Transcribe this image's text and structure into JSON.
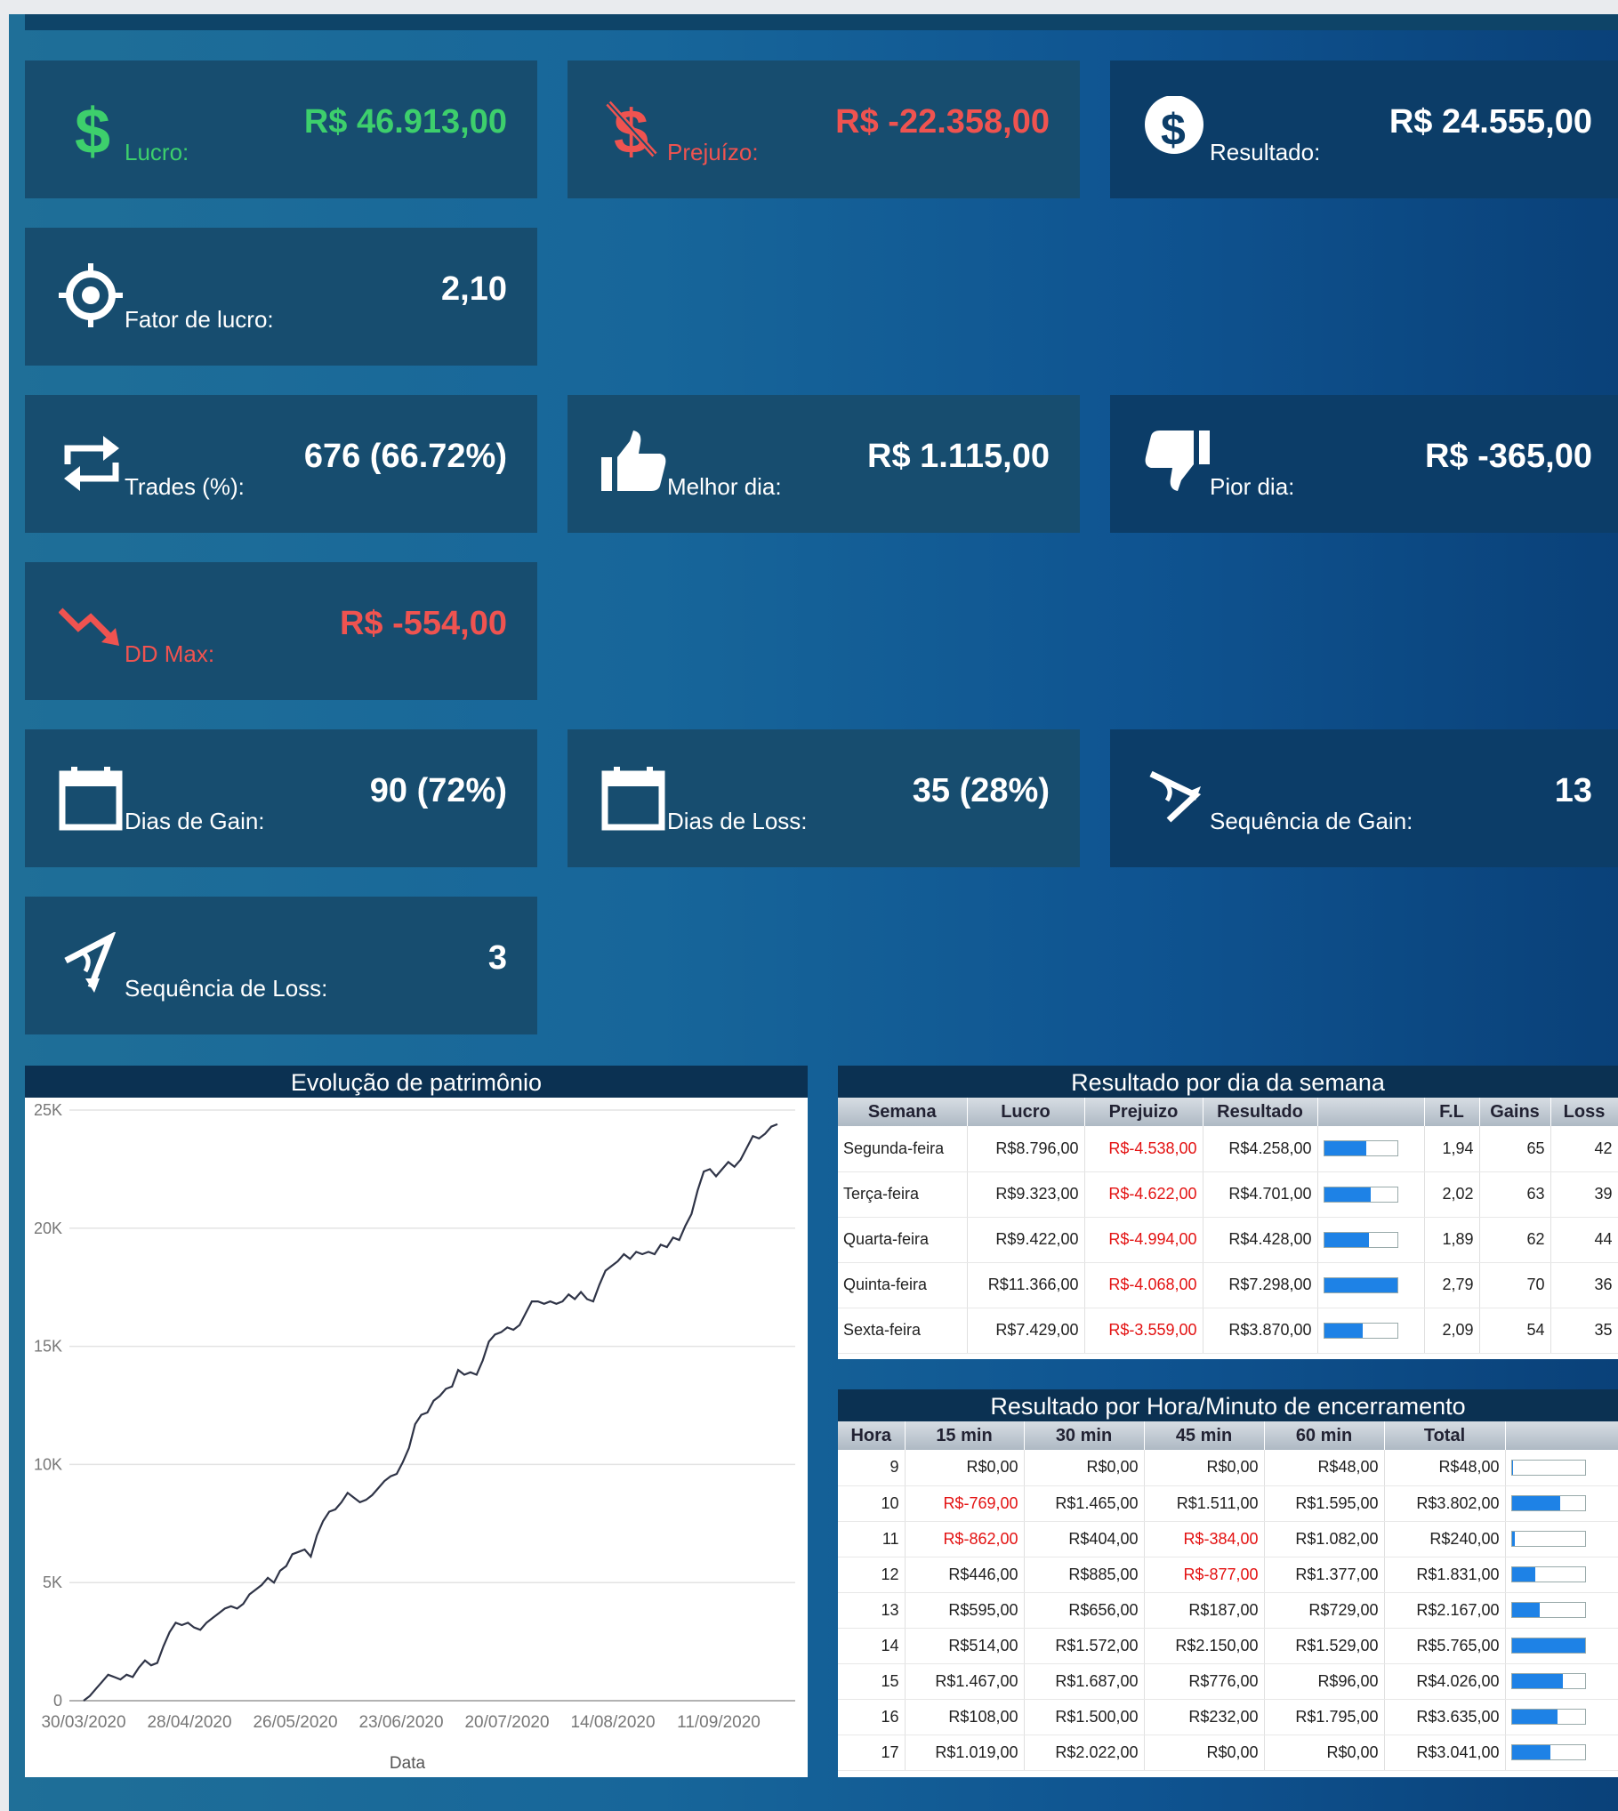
{
  "colors": {
    "positive": "#3dcf6c",
    "negative": "#ef5350",
    "card_bg": "#174d6f",
    "bar_fill": "#1e82e6"
  },
  "cards": {
    "lucro": {
      "icon": "dollar-icon",
      "label": "Lucro:",
      "value": "R$ 46.913,00"
    },
    "prejuizo": {
      "icon": "dollar-off-icon",
      "label": "Prejuízo:",
      "value": "R$ -22.358,00"
    },
    "resultado": {
      "icon": "dollar-circle-icon",
      "label": "Resultado:",
      "value": "R$ 24.555,00"
    },
    "fator": {
      "icon": "target-icon",
      "label": "Fator de lucro:",
      "value": "2,10"
    },
    "trades": {
      "icon": "repeat-icon",
      "label": "Trades (%):",
      "value": "676 (66.72%)"
    },
    "melhor": {
      "icon": "thumbs-up-icon",
      "label": "Melhor dia:",
      "value": "R$ 1.115,00"
    },
    "pior": {
      "icon": "thumbs-down-icon",
      "label": "Pior dia:",
      "value": "R$ -365,00"
    },
    "ddmax": {
      "icon": "trending-down-icon",
      "label": "DD Max:",
      "value": "R$ -554,00"
    },
    "dias_gain": {
      "icon": "calendar-icon",
      "label": "Dias de Gain:",
      "value": "90 (72%)"
    },
    "dias_loss": {
      "icon": "calendar-icon",
      "label": "Dias de Loss:",
      "value": "35 (28%)"
    },
    "seq_gain": {
      "icon": "angle-up-icon",
      "label": "Sequência de Gain:",
      "value": "13"
    },
    "seq_loss": {
      "icon": "angle-down-icon",
      "label": "Sequência de Loss:",
      "value": "3"
    }
  },
  "weekday": {
    "title": "Resultado por dia da semana",
    "headers": [
      "Semana",
      "Lucro",
      "Prejuizo",
      "Resultado",
      "",
      "F.L",
      "Gains",
      "Loss"
    ],
    "rows": [
      {
        "day": "Segunda-feira",
        "lucro": "R$8.796,00",
        "prejuizo": "R$-4.538,00",
        "resultado": "R$4.258,00",
        "bar": 0.58,
        "fl": "1,94",
        "gains": "65",
        "loss": "42"
      },
      {
        "day": "Terça-feira",
        "lucro": "R$9.323,00",
        "prejuizo": "R$-4.622,00",
        "resultado": "R$4.701,00",
        "bar": 0.64,
        "fl": "2,02",
        "gains": "63",
        "loss": "39"
      },
      {
        "day": "Quarta-feira",
        "lucro": "R$9.422,00",
        "prejuizo": "R$-4.994,00",
        "resultado": "R$4.428,00",
        "bar": 0.61,
        "fl": "1,89",
        "gains": "62",
        "loss": "44"
      },
      {
        "day": "Quinta-feira",
        "lucro": "R$11.366,00",
        "prejuizo": "R$-4.068,00",
        "resultado": "R$7.298,00",
        "bar": 1.0,
        "fl": "2,79",
        "gains": "70",
        "loss": "36"
      },
      {
        "day": "Sexta-feira",
        "lucro": "R$7.429,00",
        "prejuizo": "R$-3.559,00",
        "resultado": "R$3.870,00",
        "bar": 0.53,
        "fl": "2,09",
        "gains": "54",
        "loss": "35"
      }
    ]
  },
  "hourly": {
    "title": "Resultado por Hora/Minuto de encerramento",
    "headers": [
      "Hora",
      "15 min",
      "30 min",
      "45 min",
      "60 min",
      "Total",
      ""
    ],
    "rows": [
      {
        "hora": "9",
        "m15": "R$0,00",
        "m30": "R$0,00",
        "m45": "R$0,00",
        "m60": "R$48,00",
        "total": "R$48,00",
        "bar": 0.01
      },
      {
        "hora": "10",
        "m15": "R$-769,00",
        "m30": "R$1.465,00",
        "m45": "R$1.511,00",
        "m60": "R$1.595,00",
        "total": "R$3.802,00",
        "bar": 0.66
      },
      {
        "hora": "11",
        "m15": "R$-862,00",
        "m30": "R$404,00",
        "m45": "R$-384,00",
        "m60": "R$1.082,00",
        "total": "R$240,00",
        "bar": 0.04
      },
      {
        "hora": "12",
        "m15": "R$446,00",
        "m30": "R$885,00",
        "m45": "R$-877,00",
        "m60": "R$1.377,00",
        "total": "R$1.831,00",
        "bar": 0.32
      },
      {
        "hora": "13",
        "m15": "R$595,00",
        "m30": "R$656,00",
        "m45": "R$187,00",
        "m60": "R$729,00",
        "total": "R$2.167,00",
        "bar": 0.38
      },
      {
        "hora": "14",
        "m15": "R$514,00",
        "m30": "R$1.572,00",
        "m45": "R$2.150,00",
        "m60": "R$1.529,00",
        "total": "R$5.765,00",
        "bar": 1.0
      },
      {
        "hora": "15",
        "m15": "R$1.467,00",
        "m30": "R$1.687,00",
        "m45": "R$776,00",
        "m60": "R$96,00",
        "total": "R$4.026,00",
        "bar": 0.7
      },
      {
        "hora": "16",
        "m15": "R$108,00",
        "m30": "R$1.500,00",
        "m45": "R$232,00",
        "m60": "R$1.795,00",
        "total": "R$3.635,00",
        "bar": 0.63
      },
      {
        "hora": "17",
        "m15": "R$1.019,00",
        "m30": "R$2.022,00",
        "m45": "R$0,00",
        "m60": "R$0,00",
        "total": "R$3.041,00",
        "bar": 0.53
      }
    ]
  },
  "chart_data": {
    "type": "line",
    "title": "Evolução de patrimônio",
    "xlabel": "Data",
    "ylabel": "",
    "ylim": [
      0,
      25000
    ],
    "yticks": [
      "0",
      "5K",
      "10K",
      "15K",
      "20K",
      "25K"
    ],
    "xticks": [
      "30/03/2020",
      "28/04/2020",
      "26/05/2020",
      "23/06/2020",
      "20/07/2020",
      "14/08/2020",
      "11/09/2020"
    ],
    "series": [
      {
        "values": [
          0,
          200,
          500,
          800,
          1100,
          1000,
          900,
          1100,
          1000,
          1400,
          1700,
          1500,
          1600,
          2300,
          2900,
          3300,
          3200,
          3300,
          3100,
          3000,
          3300,
          3500,
          3700,
          3900,
          4000,
          3900,
          4100,
          4500,
          4700,
          4900,
          5200,
          5000,
          5500,
          5700,
          6200,
          6300,
          6400,
          6100,
          7000,
          7600,
          8000,
          8100,
          8400,
          8800,
          8600,
          8400,
          8500,
          8700,
          9000,
          9300,
          9500,
          9600,
          10100,
          10700,
          11700,
          12100,
          12200,
          12700,
          12900,
          13200,
          13300,
          14000,
          13800,
          13900,
          13800,
          14400,
          15200,
          15500,
          15600,
          15800,
          15700,
          15900,
          16400,
          16900,
          16900,
          16800,
          16900,
          16800,
          16900,
          17200,
          17000,
          17300,
          17000,
          16900,
          17600,
          18200,
          18400,
          18600,
          18900,
          18700,
          19000,
          18900,
          19000,
          18900,
          19300,
          19200,
          19600,
          19500,
          20100,
          20600,
          21600,
          22400,
          22500,
          22200,
          22500,
          22800,
          22600,
          22900,
          23400,
          23900,
          23800,
          24000,
          24300,
          24400
        ]
      }
    ]
  }
}
